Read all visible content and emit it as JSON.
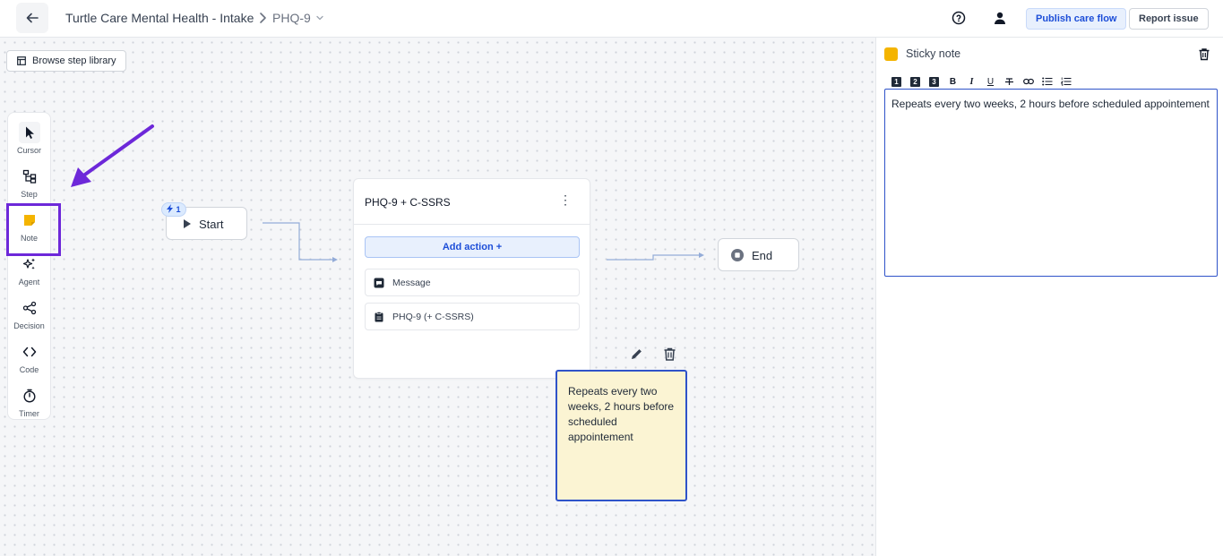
{
  "header": {
    "back_icon": "arrow-left-icon",
    "title": "Turtle Care Mental Health - Intake",
    "subtitle": "PHQ-9",
    "publish_label": "Publish care flow",
    "report_label": "Report issue"
  },
  "canvas": {
    "library_button": "Browse step library",
    "toolbar": [
      {
        "label": "Cursor",
        "icon": "cursor-icon"
      },
      {
        "label": "Step",
        "icon": "step-icon"
      },
      {
        "label": "Note",
        "icon": "note-icon"
      },
      {
        "label": "Agent",
        "icon": "sparkles-icon"
      },
      {
        "label": "Decision",
        "icon": "decision-icon"
      },
      {
        "label": "Code",
        "icon": "code-icon"
      },
      {
        "label": "Timer",
        "icon": "timer-icon"
      }
    ],
    "start": {
      "label": "Start",
      "trigger_count": "1"
    },
    "step": {
      "title": "PHQ-9 + C-SSRS",
      "add_action": "Add action +",
      "actions": [
        {
          "label": "Message",
          "icon": "message-icon"
        },
        {
          "label": "PHQ-9 (+ C-SSRS)",
          "icon": "form-icon"
        }
      ]
    },
    "end": {
      "label": "End"
    },
    "sticky_note": {
      "text": "Repeats every two weeks, 2 hours before scheduled appointement"
    }
  },
  "panel": {
    "title": "Sticky note",
    "swatch_color": "#f4b400",
    "toolbar": [
      "heading-1",
      "heading-2",
      "heading-3",
      "bold",
      "italic",
      "underline",
      "strikethrough",
      "link",
      "bullet-list",
      "numbered-list"
    ],
    "heading_labels": [
      "1",
      "2",
      "3"
    ],
    "bold_label": "B",
    "italic_label": "I",
    "underline_label": "U",
    "editor_text": "Repeats every two weeks, 2 hours before scheduled appointement"
  },
  "colors": {
    "accent": "#1d4ed8",
    "highlight": "#6d28d9",
    "sticky_bg": "#fbf4d3"
  }
}
